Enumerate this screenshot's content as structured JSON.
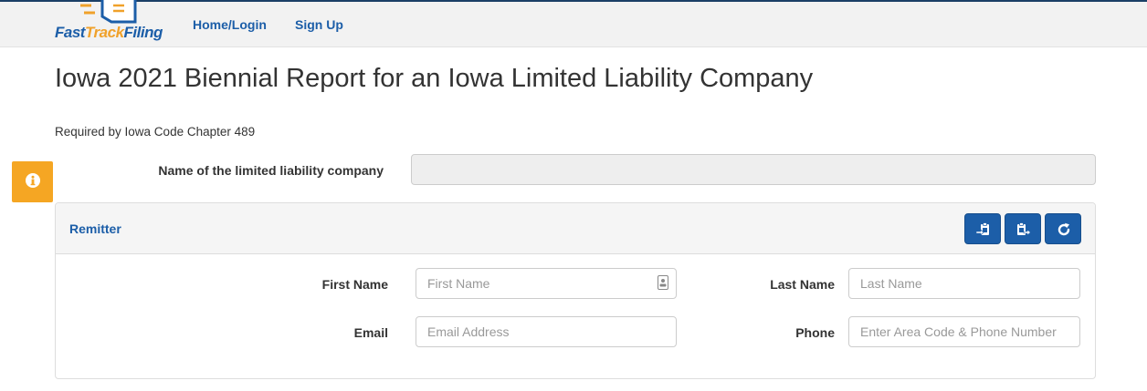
{
  "nav": {
    "logo_part1": "Fast",
    "logo_part2": "Track",
    "logo_part3": "Filing",
    "home_login": "Home/Login",
    "sign_up": "Sign Up"
  },
  "page": {
    "title": "Iowa 2021 Biennial Report for an Iowa Limited Liability Company",
    "subtitle": "Required by Iowa Code Chapter 489"
  },
  "company": {
    "label": "Name of the limited liability company",
    "value": ""
  },
  "remitter": {
    "title": "Remitter",
    "buttons": [
      "paste-in-icon",
      "paste-out-icon",
      "refresh-icon"
    ],
    "first_name_label": "First Name",
    "first_name_placeholder": "First Name",
    "last_name_label": "Last Name",
    "last_name_placeholder": "Last Name",
    "email_label": "Email",
    "email_placeholder": "Email Address",
    "phone_label": "Phone",
    "phone_placeholder": "Enter Area Code & Phone Number"
  },
  "colors": {
    "brand_blue": "#1c5ea8",
    "brand_orange": "#f5a623",
    "nav_border": "#1b3f66"
  }
}
